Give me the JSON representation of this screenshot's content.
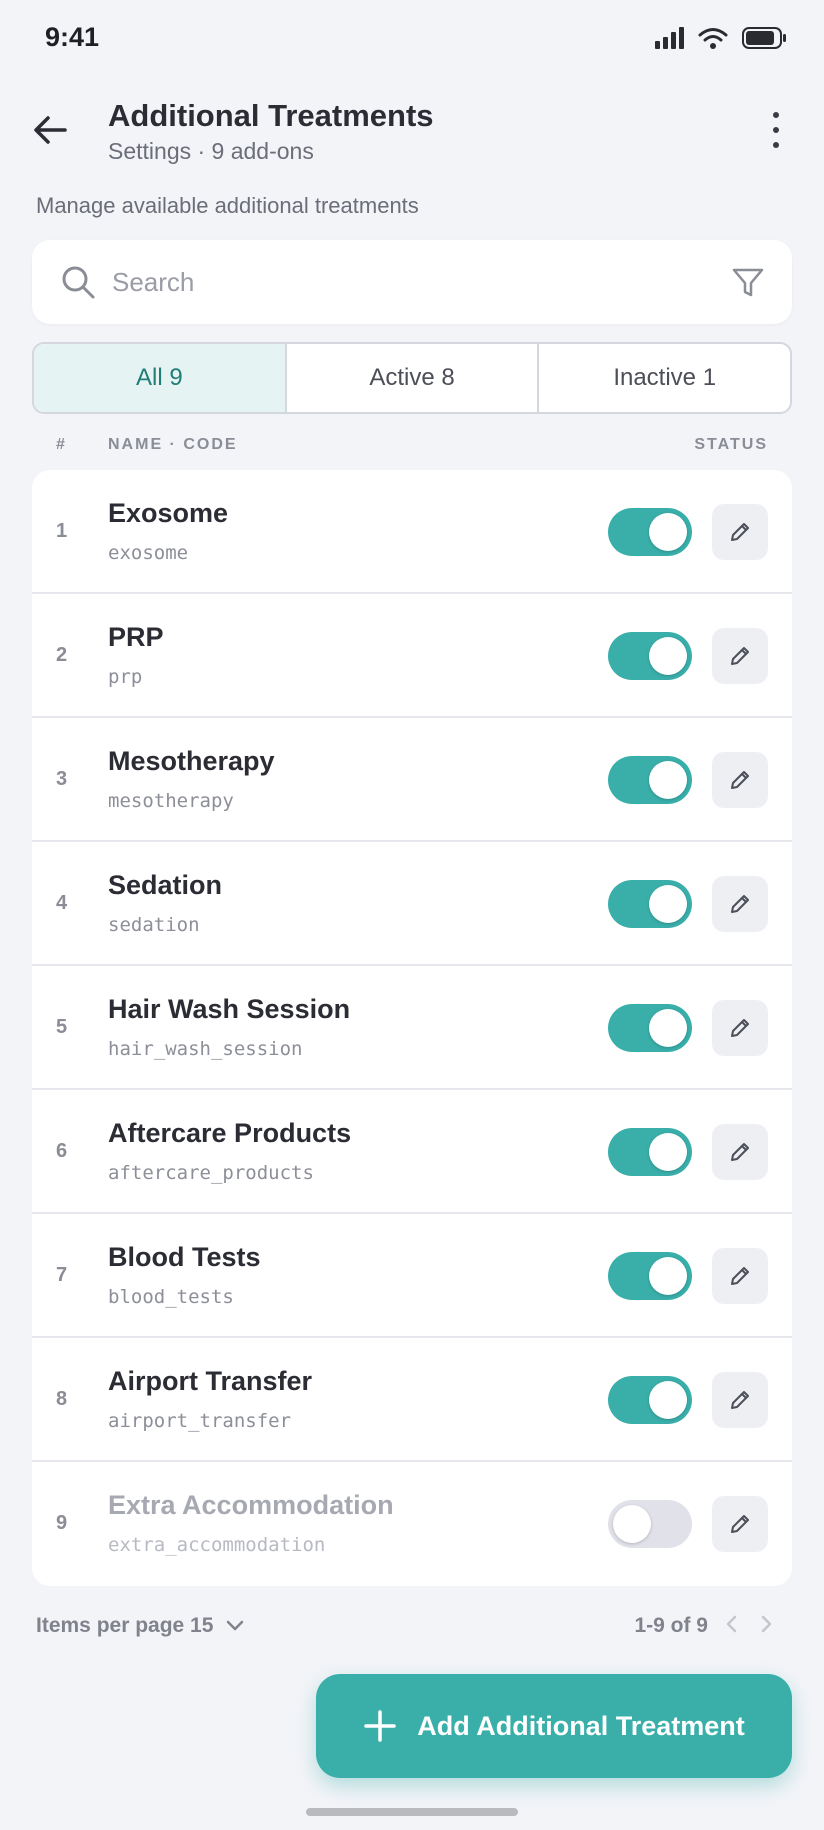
{
  "status_bar": {
    "time": "9:41"
  },
  "header": {
    "title": "Additional Treatments",
    "subtitle": "Settings · 9 add-ons",
    "back_icon": "arrow-left-icon",
    "more_icon": "more-vertical-icon"
  },
  "description": "Manage available additional treatments",
  "search": {
    "placeholder": "Search",
    "value": ""
  },
  "tabs": [
    {
      "label": "All 9",
      "active": true
    },
    {
      "label": "Active 8",
      "active": false
    },
    {
      "label": "Inactive 1",
      "active": false
    }
  ],
  "columns": {
    "num": "#",
    "name": "NAME · CODE",
    "status": "STATUS"
  },
  "items": [
    {
      "num": "1",
      "name": "Exosome",
      "code": "exosome",
      "active": true
    },
    {
      "num": "2",
      "name": "PRP",
      "code": "prp",
      "active": true
    },
    {
      "num": "3",
      "name": "Mesotherapy",
      "code": "mesotherapy",
      "active": true
    },
    {
      "num": "4",
      "name": "Sedation",
      "code": "sedation",
      "active": true
    },
    {
      "num": "5",
      "name": "Hair Wash Session",
      "code": "hair_wash_session",
      "active": true
    },
    {
      "num": "6",
      "name": "Aftercare Products",
      "code": "aftercare_products",
      "active": true
    },
    {
      "num": "7",
      "name": "Blood Tests",
      "code": "blood_tests",
      "active": true
    },
    {
      "num": "8",
      "name": "Airport Transfer",
      "code": "airport_transfer",
      "active": true
    },
    {
      "num": "9",
      "name": "Extra Accommodation",
      "code": "extra_accommodation",
      "active": false
    }
  ],
  "pagination": {
    "per_page_label": "Items per page 15",
    "range": "1-9 of 9"
  },
  "fab": {
    "label": "Add Additional Treatment"
  },
  "colors": {
    "accent": "#3aafaa",
    "active_tab_bg": "#e5f3f3",
    "background": "#f3f4f8"
  }
}
